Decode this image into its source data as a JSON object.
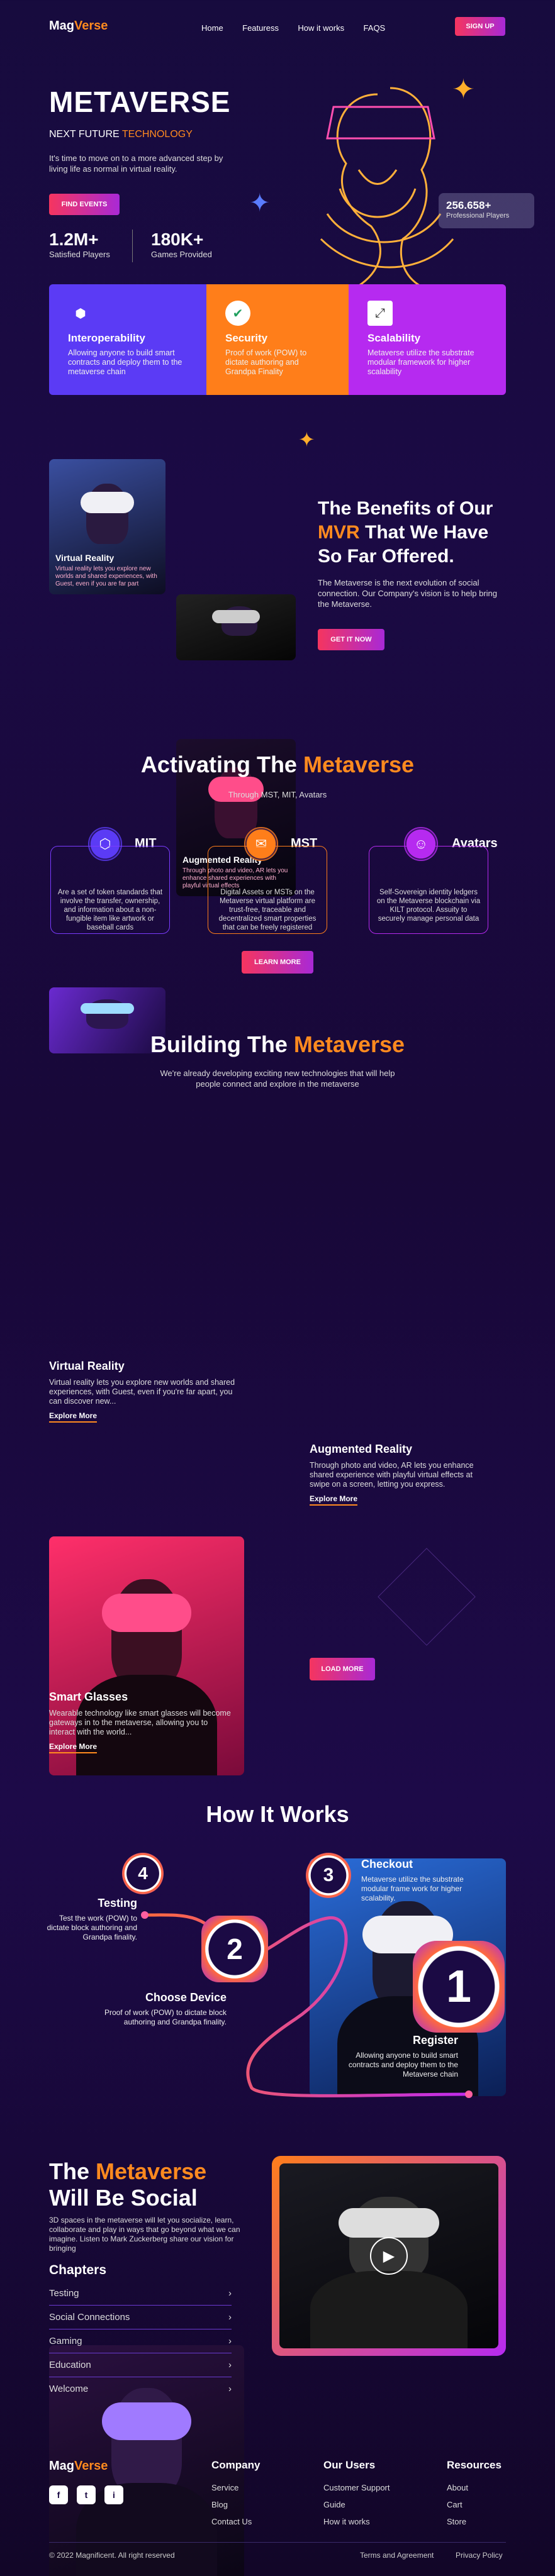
{
  "nav": {
    "logo_a": "Mag",
    "logo_b": "Verse",
    "links": [
      "Home",
      "Featuress",
      "How it works",
      "FAQS"
    ],
    "signup": "SIGN UP"
  },
  "hero": {
    "title": "METAVERSE",
    "subtitle_a": "NEXT FUTURE ",
    "subtitle_b": "TECHNOLOGY",
    "desc": "It's time to move on to a more advanced step by living life as normal in virtual reality.",
    "cta": "FIND EVENTS",
    "stats": [
      {
        "num": "1.2M+",
        "label": "Satisfied Players"
      },
      {
        "num": "180K+",
        "label": "Games Provided"
      }
    ],
    "badge_num": "256.658+",
    "badge_label": "Professional Players"
  },
  "features": [
    {
      "title": "Interoperability",
      "desc": "Allowing anyone to build smart contracts and deploy them to the metaverse chain",
      "color": "#5b3bf5"
    },
    {
      "title": "Security",
      "desc": "Proof of work (POW) to dictate authoring and Grandpa Finality",
      "color": "#ff7e1a"
    },
    {
      "title": "Scalability",
      "desc": "Metaverse utilize the substrate modular framework for higher scalability",
      "color": "#b62af0"
    }
  ],
  "benefits": {
    "title_a": "The Benefits of Our ",
    "title_b": "MVR",
    "title_c": " That We Have So Far Offered.",
    "desc": "The Metaverse is the next evolution of social connection. Our Company's vision is to help bring the Metaverse.",
    "cta": "GET IT NOW",
    "card1_title": "Virtual Reality",
    "card1_desc": "Virtual reality lets you explore new worlds and shared experiences, with Guest, even if you are far part",
    "card2_title": "Augmented Reality",
    "card2_desc": "Through photo and video, AR lets you enhance shared experiences with playful virtual effects"
  },
  "activating": {
    "title_a": "Activating The ",
    "title_b": "Metaverse",
    "sub": "Through MST, MIT, Avatars",
    "items": [
      {
        "title": "MIT",
        "desc": "Are a set of token standards that involve the transfer, ownership, and information about a non-fungible item like artwork or baseball cards"
      },
      {
        "title": "MST",
        "desc": "Digital Assets or MSTs on the Metaverse virtual platform are trust-free, traceable and decentralized smart properties that can be freely registered"
      },
      {
        "title": "Avatars",
        "desc": "Self-Sovereign identity ledgers on the Metaverse blockchain via KILT protocol. Assuity to securely manage personal data"
      }
    ],
    "cta": "LEARN MORE"
  },
  "building": {
    "title_a": "Building The ",
    "title_b": "Metaverse",
    "sub": "We're already developing exciting new technologies that will help people connect and explore in the metaverse",
    "cards": [
      {
        "title": "Virtual Reality",
        "desc": "Virtual reality lets you explore new worlds and shared experiences, with Guest, even if you're far apart, you can discover new...",
        "link": "Explore More"
      },
      {
        "title": "Augmented Reality",
        "desc": "Through photo and video, AR lets you enhance shared experience with playful virtual effects at swipe on a screen, letting you express.",
        "link": "Explore More"
      },
      {
        "title": "Smart Glasses",
        "desc": "Wearable technology like smart glasses will become gateways in to the metaverse, allowing you to interact with the world...",
        "link": "Explore More"
      }
    ],
    "cta": "LOAD MORE"
  },
  "how": {
    "title": "How It Works",
    "steps": [
      {
        "num": "4",
        "title": "Testing",
        "desc": "Test the work (POW) to dictate block authoring and Grandpa finality."
      },
      {
        "num": "3",
        "title": "Checkout",
        "desc": "Metaverse utilize the substrate modular frame work for higher scalability."
      },
      {
        "num": "2",
        "title": "Choose Device",
        "desc": "Proof of work (POW) to dictate block authoring and Grandpa finality."
      },
      {
        "num": "1",
        "title": "Register",
        "desc": "Allowing anyone to build smart contracts and deploy them to the Metaverse chain"
      }
    ]
  },
  "social": {
    "title_a": "The ",
    "title_b": "Metaverse",
    "title_c": "Will Be Social",
    "desc": "3D spaces in the metaverse will let you socialize, learn, collaborate and play in ways that go beyond what we can imagine. Listen to Mark Zuckerberg share our vision for bringing",
    "chapters_title": "Chapters",
    "chapters": [
      "Testing",
      "Social Connections",
      "Gaming",
      "Education",
      "Welcome"
    ]
  },
  "footer": {
    "cols": [
      {
        "title": "Company",
        "links": [
          "Service",
          "Blog",
          "Contact Us"
        ]
      },
      {
        "title": "Our Users",
        "links": [
          "Customer Support",
          "Guide",
          "How it works"
        ]
      },
      {
        "title": "Resources",
        "links": [
          "About",
          "Cart",
          "Store"
        ]
      }
    ],
    "social": [
      "f",
      "t",
      "i"
    ],
    "copyright": "© 2022 Magnificent. All right reserved",
    "terms": "Terms and Agreement",
    "privacy": "Privacy Policy"
  }
}
